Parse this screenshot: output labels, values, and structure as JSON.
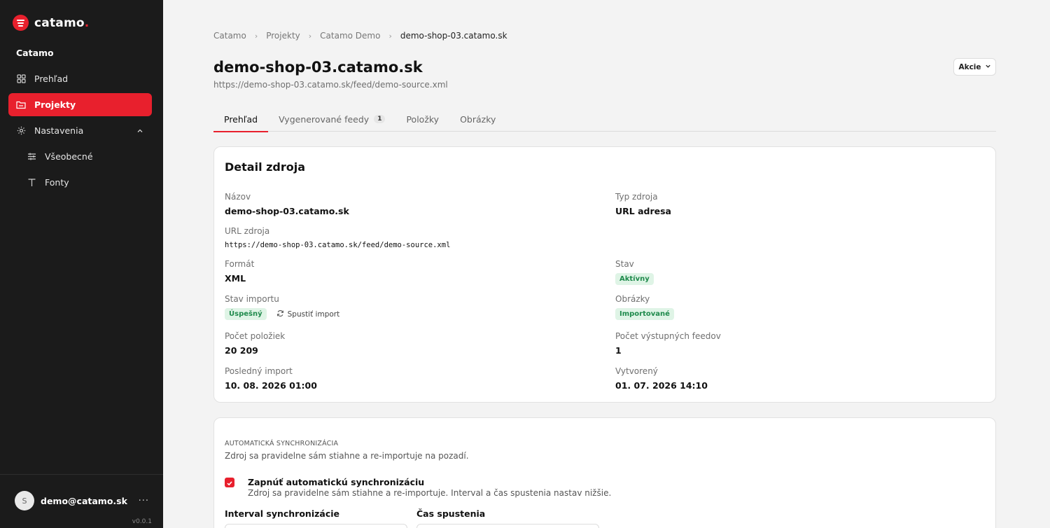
{
  "brand": {
    "name": "catamo",
    "dot": ".",
    "accent": "#e8202d"
  },
  "sidebar": {
    "org": "Catamo",
    "items": [
      {
        "label": "Prehľad",
        "icon": "grid-icon",
        "active": false
      },
      {
        "label": "Projekty",
        "icon": "folder-icon",
        "active": true
      },
      {
        "label": "Nastavenia",
        "icon": "gear-icon",
        "active": false
      },
      {
        "label": "Všeobecné",
        "icon": "sliders-icon",
        "active": false
      },
      {
        "label": "Fonty",
        "icon": "type-icon",
        "active": false
      }
    ],
    "user": {
      "initial": "S",
      "email": "demo@catamo.sk",
      "more": "···"
    },
    "version": "v0.0.1"
  },
  "breadcrumb": [
    "Catamo",
    "Projekty",
    "Catamo Demo",
    "demo-shop-03.catamo.sk"
  ],
  "page": {
    "title": "demo-shop-03.catamo.sk",
    "url": "https://demo-shop-03.catamo.sk/feed/demo-source.xml",
    "actions_label": "Akcie"
  },
  "tabs": [
    {
      "label": "Prehľad",
      "active": true
    },
    {
      "label": "Vygenerované feedy",
      "badge": "1"
    },
    {
      "label": "Položky"
    },
    {
      "label": "Obrázky"
    }
  ],
  "detail": {
    "title": "Detail zdroja",
    "name": {
      "label": "Názov",
      "value": "demo-shop-03.catamo.sk"
    },
    "source_type": {
      "label": "Typ zdroja",
      "value": "URL adresa"
    },
    "source_url": {
      "label": "URL zdroja",
      "value": "https://demo-shop-03.catamo.sk/feed/demo-source.xml"
    },
    "format": {
      "label": "Formát",
      "value": "XML"
    },
    "status": {
      "label": "Stav",
      "value": "Aktívny"
    },
    "import_status": {
      "label": "Stav importu",
      "value": "Úspešný",
      "action": "Spustiť import"
    },
    "images": {
      "label": "Obrázky",
      "value": "Importované"
    },
    "item_count": {
      "label": "Počet položiek",
      "value": "20 209"
    },
    "output_feeds": {
      "label": "Počet výstupných feedov",
      "value": "1"
    },
    "last_import": {
      "label": "Posledný import",
      "value": "10. 08. 2026 01:00"
    },
    "created": {
      "label": "Vytvorený",
      "value": "01. 07. 2026 14:10"
    }
  },
  "sync": {
    "heading": "AUTOMATICKÁ SYNCHRONIZÁCIA",
    "description": "Zdroj sa pravidelne sám stiahne a re-importuje na pozadí.",
    "toggle_label": "Zapnúť automatickú synchronizáciu",
    "toggle_checked": true,
    "toggle_desc": "Zdroj sa pravidelne sám stiahne a re-importuje. Interval a čas spustenia nastav nižšie.",
    "interval_label": "Interval synchronizácie",
    "time_label": "Čas spustenia"
  }
}
